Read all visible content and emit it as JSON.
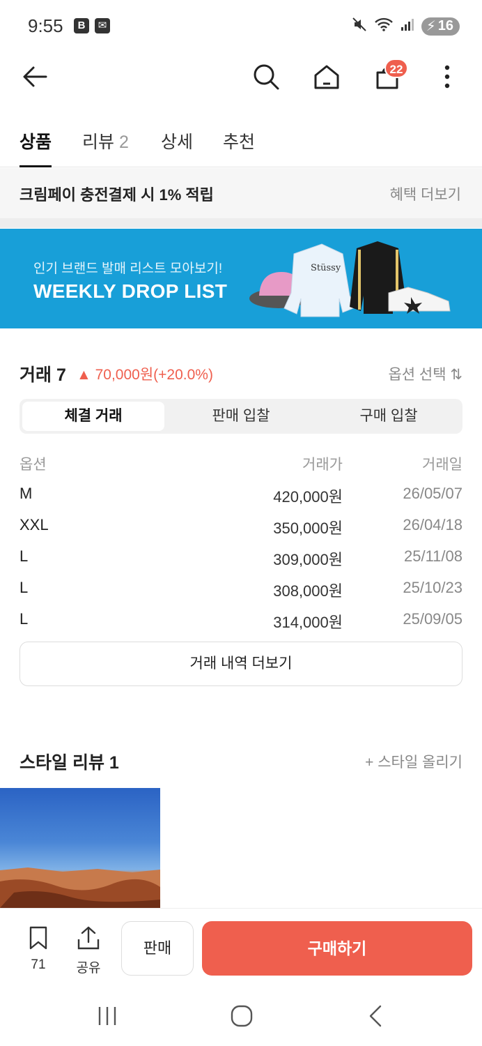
{
  "status": {
    "time": "9:55",
    "battery": "16"
  },
  "header": {
    "cart_count": "22"
  },
  "tabs": [
    {
      "label": "상품"
    },
    {
      "label": "리뷰",
      "count": "2"
    },
    {
      "label": "상세"
    },
    {
      "label": "추천"
    }
  ],
  "promo": {
    "text": "크림페이 충전결제 시 1% 적립",
    "link": "혜택 더보기"
  },
  "banner": {
    "subtitle": "인기 브랜드 발매 리스트 모아보기!",
    "title": "WEEKLY DROP LIST"
  },
  "trade": {
    "title": "거래 7",
    "change": "▲ 70,000원(+20.0%)",
    "option_select": "옵션 선택 ⇅",
    "segments": [
      "체결 거래",
      "판매 입찰",
      "구매 입찰"
    ],
    "columns": {
      "option": "옵션",
      "price": "거래가",
      "date": "거래일"
    },
    "rows": [
      {
        "option": "M",
        "price": "420,000원",
        "date": "26/05/07"
      },
      {
        "option": "XXL",
        "price": "350,000원",
        "date": "26/04/18"
      },
      {
        "option": "L",
        "price": "309,000원",
        "date": "25/11/08"
      },
      {
        "option": "L",
        "price": "308,000원",
        "date": "25/10/23"
      },
      {
        "option": "L",
        "price": "314,000원",
        "date": "25/09/05"
      }
    ],
    "more_label": "거래 내역 더보기"
  },
  "style_review": {
    "title": "스타일 리뷰 1",
    "upload_label": "+ 스타일 올리기"
  },
  "bottom": {
    "bookmark_count": "71",
    "share_label": "공유",
    "sell_label": "판매",
    "buy_label": "구매하기"
  }
}
